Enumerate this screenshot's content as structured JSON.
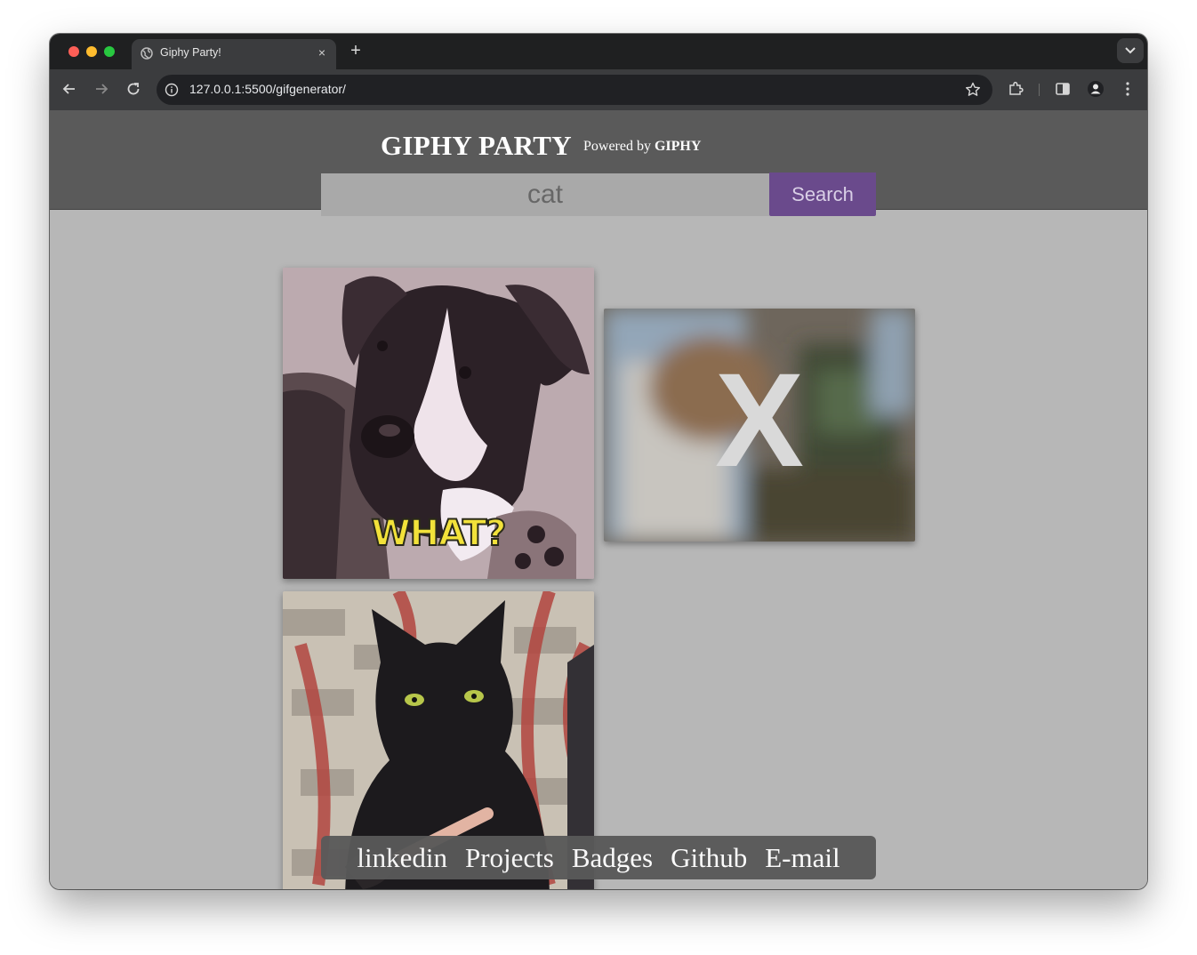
{
  "browser": {
    "tab_title": "Giphy Party!",
    "tab_close": "×",
    "new_tab": "+",
    "url": "127.0.0.1:5500/gifgenerator/"
  },
  "header": {
    "title": "GIPHY PARTY",
    "powered_prefix": "Powered by",
    "powered_brand": "GIPHY"
  },
  "search": {
    "value": "cat",
    "button_label": "Search"
  },
  "gifs": [
    {
      "caption": "WHAT?"
    },
    {
      "caption": "X"
    },
    {
      "caption": ""
    }
  ],
  "footer": {
    "links": [
      "linkedin",
      "Projects",
      "Badges",
      "Github",
      "E-mail"
    ]
  },
  "colors": {
    "accent": "#6a4a8c",
    "header_band": "#5a5a5a",
    "page_bg": "#b7b7b7"
  }
}
